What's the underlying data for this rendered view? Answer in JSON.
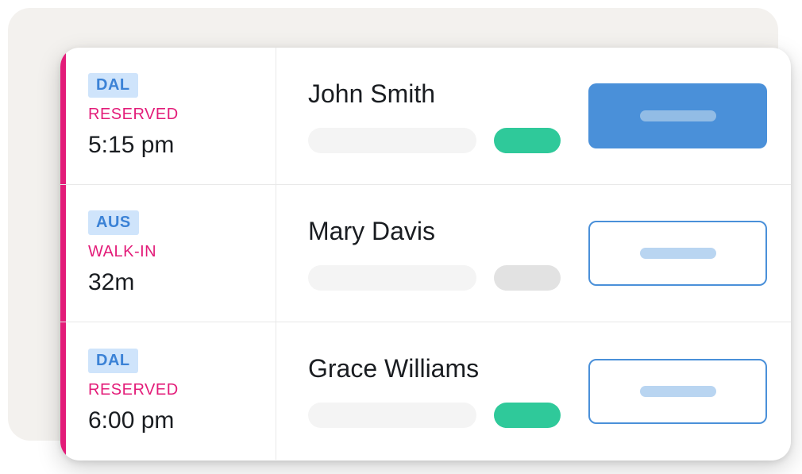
{
  "reservations": [
    {
      "location": "DAL",
      "status": "RESERVED",
      "time": "5:15 pm",
      "guest_name": "John Smith",
      "indicator": "green",
      "action_style": "filled"
    },
    {
      "location": "AUS",
      "status": "WALK-IN",
      "time": "32m",
      "guest_name": "Mary Davis",
      "indicator": "gray",
      "action_style": "outline"
    },
    {
      "location": "DAL",
      "status": "RESERVED",
      "time": "6:00 pm",
      "guest_name": "Grace Williams",
      "indicator": "green",
      "action_style": "outline"
    }
  ]
}
